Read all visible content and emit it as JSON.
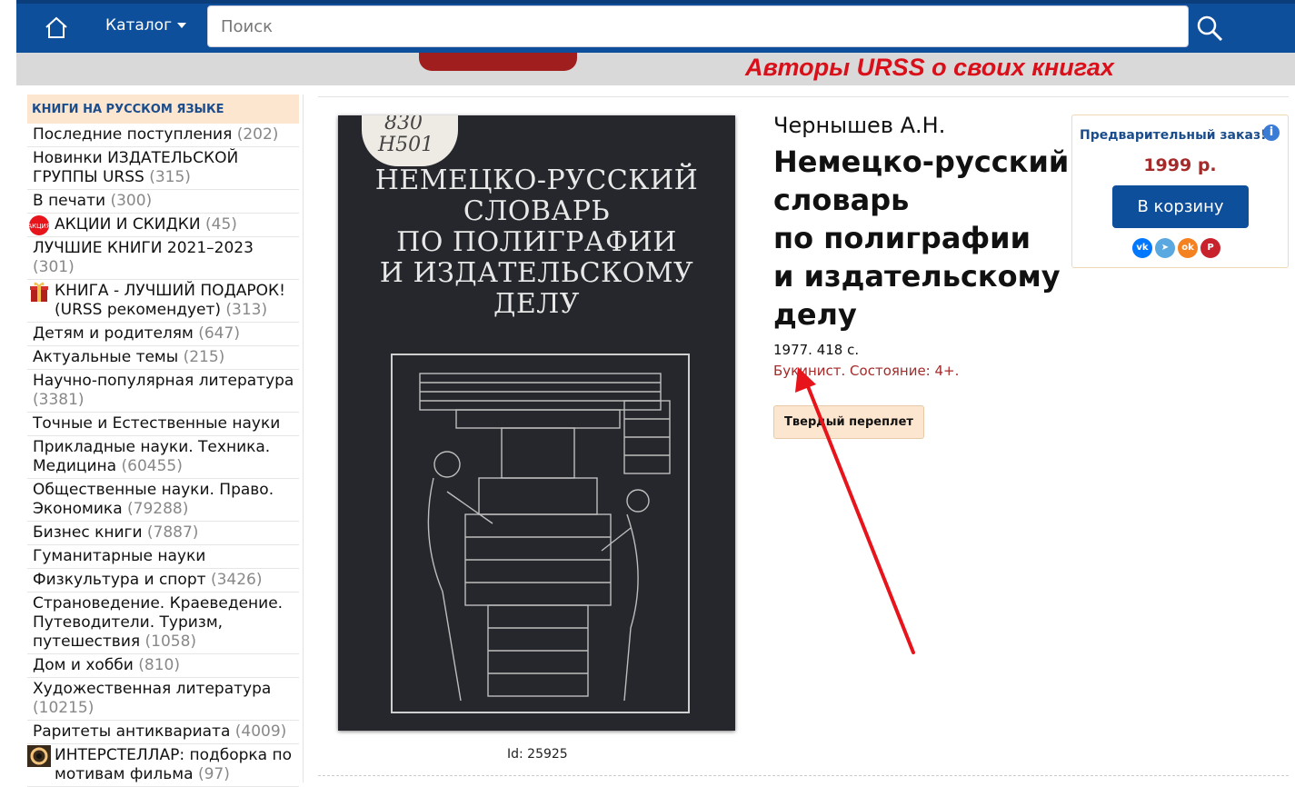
{
  "header": {
    "catalog_label": "Каталог",
    "search_placeholder": "Поиск",
    "banner_text": "Авторы URSS о своих книгах"
  },
  "sidebar": {
    "heading": "КНИГИ НА РУССКОМ ЯЗЫКЕ",
    "items": [
      {
        "label": "Последние поступления",
        "count": "(202)"
      },
      {
        "label": "Новинки ИЗДАТЕЛЬСКОЙ ГРУППЫ URSS",
        "count": "(315)"
      },
      {
        "label": "В печати",
        "count": "(300)"
      },
      {
        "label": "АКЦИИ И СКИДКИ",
        "count": "(45)",
        "icon": "sale-badge-icon"
      },
      {
        "label": "ЛУЧШИЕ КНИГИ 2021–2023",
        "count": "(301)"
      },
      {
        "label": "КНИГА - ЛУЧШИЙ ПОДАРОК! (URSS рекомендует)",
        "count": "(313)",
        "icon": "gift-icon"
      },
      {
        "label": "Детям и родителям",
        "count": "(647)"
      },
      {
        "label": "Актуальные темы",
        "count": "(215)"
      },
      {
        "label": "Научно-популярная литература",
        "count": "(3381)"
      },
      {
        "label": "Точные и Естественные науки",
        "count": ""
      },
      {
        "label": "Прикладные науки. Техника. Медицина",
        "count": "(60455)"
      },
      {
        "label": "Общественные науки. Право. Экономика",
        "count": "(79288)"
      },
      {
        "label": "Бизнес книги",
        "count": "(7887)"
      },
      {
        "label": "Гуманитарные науки",
        "count": ""
      },
      {
        "label": "Физкультура и спорт",
        "count": "(3426)"
      },
      {
        "label": "Страноведение. Краеведение. Путеводители. Туризм, путешествия",
        "count": "(1058)"
      },
      {
        "label": "Дом и хобби",
        "count": "(810)"
      },
      {
        "label": "Художественная литература",
        "count": "(10215)"
      },
      {
        "label": "Раритеты антиквариата",
        "count": "(4009)"
      },
      {
        "label": "ИНТЕРСТЕЛЛАР: подборка по мотивам фильма",
        "count": "(97)",
        "icon": "interstellar-icon"
      }
    ]
  },
  "book": {
    "cover_sticker": [
      "830",
      "Н501"
    ],
    "cover_title_lines": [
      "НЕМЕЦКО-РУССКИЙ",
      "СЛОВАРЬ",
      "ПО ПОЛИГРАФИИ",
      "И ИЗДАТЕЛЬСКОМУ",
      "ДЕЛУ"
    ],
    "id_label": "Id: 25925",
    "author": "Чернышев А.Н.",
    "title_lines": [
      "Немецко-русский",
      "словарь",
      "по полиграфии",
      "и издательскому",
      "делу"
    ],
    "meta": "1977. 418 с.",
    "condition": "Букинист. Состояние: 4+.",
    "binding": "Твердый переплет"
  },
  "order": {
    "label": "Предварительный заказ!",
    "price": "1999 р.",
    "cart_button": "В корзину",
    "socials": [
      {
        "name": "vk-icon",
        "glyph": "vk",
        "color": "#0077ff"
      },
      {
        "name": "telegram-icon",
        "glyph": "➤",
        "color": "#5aa8e0"
      },
      {
        "name": "odnoklassniki-icon",
        "glyph": "ok",
        "color": "#f58220"
      },
      {
        "name": "pinterest-icon",
        "glyph": "P",
        "color": "#c8232c"
      }
    ]
  },
  "colors": {
    "brand": "#0e4f9c",
    "accent_red": "#a52a2a",
    "banner_red": "#d9101a"
  }
}
